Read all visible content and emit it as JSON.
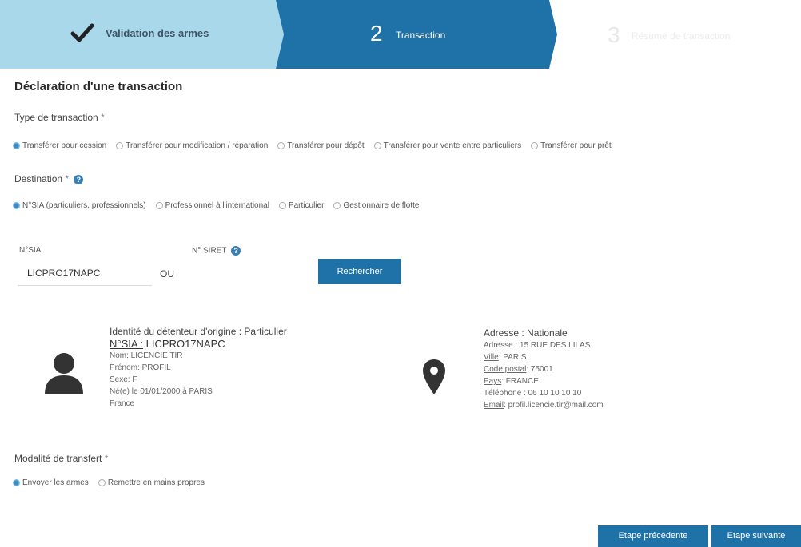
{
  "stepper": {
    "step1_label": "Validation des armes",
    "step2_number": "2",
    "step2_label": "Transaction",
    "step3_number": "3",
    "step3_label": "Résumé de transaction"
  },
  "page_title": "Déclaration d'une transaction",
  "transaction_type": {
    "label": "Type de transaction",
    "required": "*",
    "options": [
      {
        "label": "Transférer pour cession",
        "selected": true
      },
      {
        "label": "Transférer pour modification / réparation",
        "selected": false
      },
      {
        "label": "Transférer pour dépôt",
        "selected": false
      },
      {
        "label": "Transférer pour vente entre particuliers",
        "selected": false
      },
      {
        "label": "Transférer pour prêt",
        "selected": false
      }
    ]
  },
  "destination": {
    "label": "Destination",
    "required": "*",
    "help": "?",
    "options": [
      {
        "label": "N°SIA (particuliers, professionnels)",
        "selected": true
      },
      {
        "label": "Professionnel à l'international",
        "selected": false
      },
      {
        "label": "Particulier",
        "selected": false
      },
      {
        "label": "Gestionnaire de flotte",
        "selected": false
      }
    ]
  },
  "search": {
    "sia_label": "N°SIA",
    "sia_value": "LICPRO17NAPC",
    "or_label": "OU",
    "siret_label": "N° SIRET",
    "siret_help": "?",
    "button_label": "Rechercher"
  },
  "holder": {
    "title": "Identité du détenteur d'origine : Particulier",
    "sia_label": "N°SIA :",
    "sia_value": "LICPRO17NAPC",
    "nom_label": "Nom",
    "nom_value": ": LICENCIE TIR",
    "prenom_label": "Prénom",
    "prenom_value": ": PROFIL",
    "sexe_label": "Sexe",
    "sexe_value": ": F",
    "birth": "Né(e) le 01/01/2000 à PARIS",
    "country": "France"
  },
  "address": {
    "title": "Adresse : Nationale",
    "adresse": "Adresse : 15 RUE DES LILAS",
    "ville_label": "Ville",
    "ville_value": ": PARIS",
    "cp_label": "Code postal",
    "cp_value": ": 75001",
    "pays_label": "Pays",
    "pays_value": ": FRANCE",
    "telephone": "Téléphone : 06 10 10 10 10",
    "email_label": "Email",
    "email_value": ": profil.licencie.tir@mail.com"
  },
  "transfer_mode": {
    "label": "Modalité de transfert",
    "required": "*",
    "options": [
      {
        "label": "Envoyer les armes",
        "selected": true
      },
      {
        "label": "Remettre en mains propres",
        "selected": false
      }
    ]
  },
  "footer": {
    "prev_label": "Etape précédente",
    "next_label": "Etape suivante"
  },
  "colors": {
    "step1_bg": "#a9d8ea",
    "step2_bg": "#1f72a7",
    "button_bg": "#1f72a7",
    "radio_selected": "#3a8cc4"
  },
  "icons": {
    "step1": "check-icon",
    "holder": "person-icon",
    "address": "map-pin-icon",
    "help": "question-circle-icon"
  }
}
